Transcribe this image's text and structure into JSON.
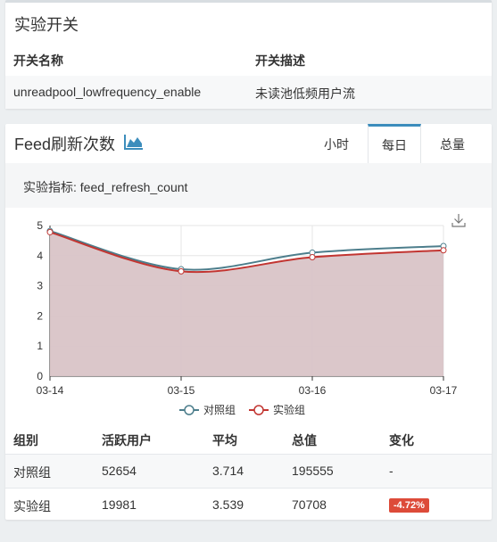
{
  "switch_panel": {
    "title": "实验开关",
    "columns": [
      "开关名称",
      "开关描述"
    ],
    "rows": [
      {
        "name": "unreadpool_lowfrequency_enable",
        "desc": "未读池低频用户流"
      }
    ]
  },
  "metric_panel": {
    "title": "Feed刷新次数",
    "tabs": [
      "小时",
      "每日",
      "总量"
    ],
    "active_tab": "每日",
    "indicator": "实验指标: feed_refresh_count",
    "legend": [
      "对照组",
      "实验组"
    ]
  },
  "chart_data": {
    "type": "line",
    "categories": [
      "03-14",
      "03-15",
      "03-16",
      "03-17"
    ],
    "series": [
      {
        "name": "对照组",
        "values": [
          4.82,
          3.55,
          4.1,
          4.32
        ],
        "color": "#4d7e8c"
      },
      {
        "name": "实验组",
        "values": [
          4.78,
          3.48,
          3.95,
          4.18
        ],
        "color": "#c23531"
      }
    ],
    "ylim": [
      0,
      5
    ],
    "yticks": [
      "0",
      "1",
      "2",
      "3",
      "4",
      "5"
    ],
    "area_fill": "#d9c4c7",
    "grid": true,
    "legend_position": "bottom"
  },
  "stats_table": {
    "columns": [
      "组别",
      "活跃用户",
      "平均",
      "总值",
      "变化"
    ],
    "rows": [
      {
        "group": "对照组",
        "active": "52654",
        "avg": "3.714",
        "total": "195555",
        "change": "-"
      },
      {
        "group": "实验组",
        "active": "19981",
        "avg": "3.539",
        "total": "70708",
        "change": "-4.72%"
      }
    ]
  },
  "colors": {
    "accent": "#3c8dbc",
    "badge": "#dd4b39"
  }
}
